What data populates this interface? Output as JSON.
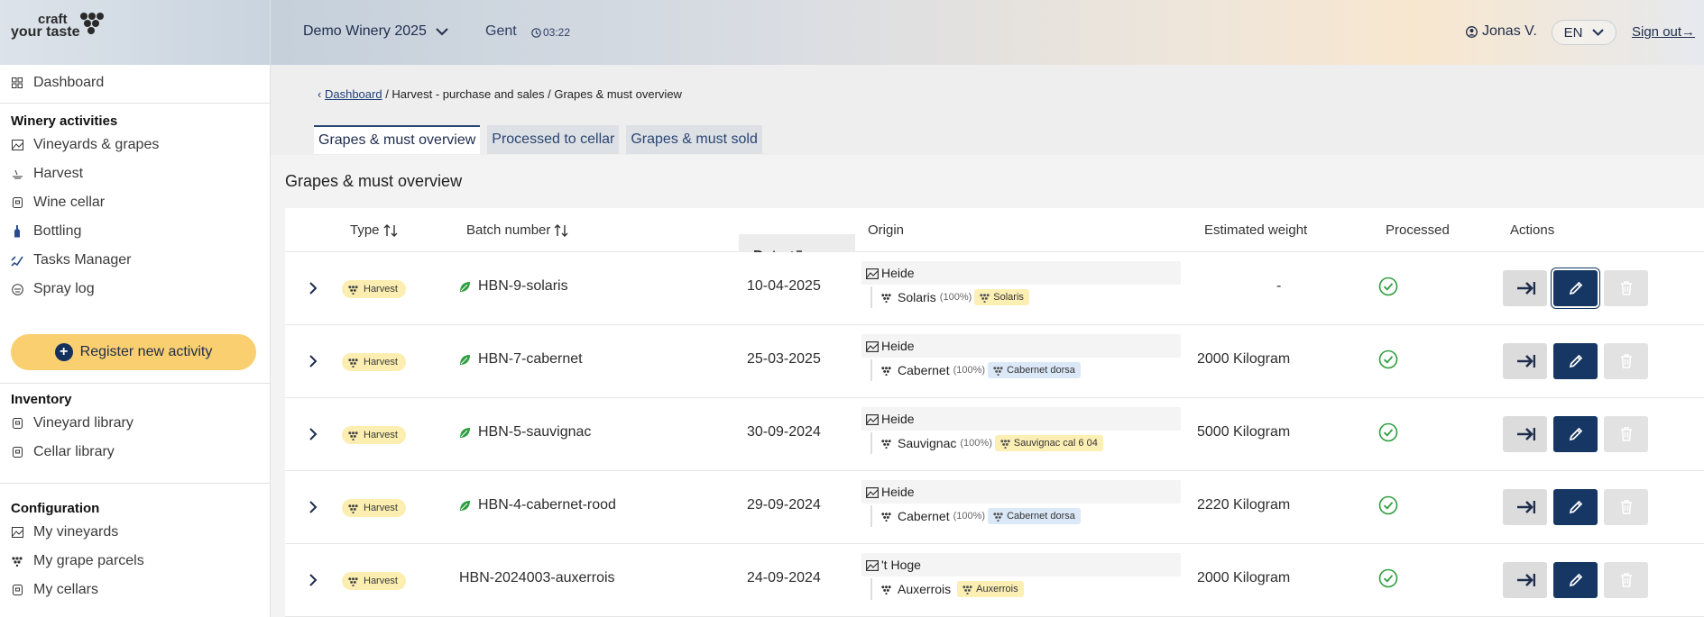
{
  "logo": {
    "line1": "craft",
    "line2": "your taste"
  },
  "sidebar": {
    "dashboard": "Dashboard",
    "winery_title": "Winery activities",
    "winery_items": [
      "Vineyards & grapes",
      "Harvest",
      "Wine cellar",
      "Bottling",
      "Tasks Manager",
      "Spray log"
    ],
    "register_label": "Register new activity",
    "inventory_title": "Inventory",
    "inventory_items": [
      "Vineyard library",
      "Cellar library"
    ],
    "config_title": "Configuration",
    "config_items": [
      "My vineyards",
      "My grape parcels",
      "My cellars"
    ]
  },
  "header": {
    "winery": "Demo Winery 2025",
    "city": "Gent",
    "time": "03:22",
    "user": "Jonas V.",
    "lang": "EN",
    "signout": "Sign out"
  },
  "breadcrumb": {
    "back": "‹",
    "link": "Dashboard",
    "rest": " / Harvest - purchase and sales / Grapes & must overview"
  },
  "tabs": [
    "Grapes & must overview",
    "Processed to cellar",
    "Grapes & must sold"
  ],
  "page_title": "Grapes & must overview",
  "table": {
    "headers": {
      "type": "Type",
      "batch": "Batch number",
      "date": "Date",
      "origin": "Origin",
      "weight": "Estimated weight",
      "processed": "Processed",
      "actions": "Actions"
    },
    "rows": [
      {
        "type": "Harvest",
        "batch": "HBN-9-solaris",
        "leaf": true,
        "date": "10-04-2025",
        "origin": "Heide",
        "variety": "Solaris",
        "pct": "(100%)",
        "chip": "Solaris",
        "chip_color": "yellow",
        "weight": "-",
        "processed": true
      },
      {
        "type": "Harvest",
        "batch": "HBN-7-cabernet",
        "leaf": true,
        "date": "25-03-2025",
        "origin": "Heide",
        "variety": "Cabernet",
        "pct": "(100%)",
        "chip": "Cabernet dorsa",
        "chip_color": "blue",
        "weight": "2000 Kilogram",
        "processed": true
      },
      {
        "type": "Harvest",
        "batch": "HBN-5-sauvignac",
        "leaf": true,
        "date": "30-09-2024",
        "origin": "Heide",
        "variety": "Sauvignac",
        "pct": "(100%)",
        "chip": "Sauvignac cal 6 04",
        "chip_color": "yellow",
        "weight": "5000 Kilogram",
        "processed": true
      },
      {
        "type": "Harvest",
        "batch": "HBN-4-cabernet-rood",
        "leaf": true,
        "date": "29-09-2024",
        "origin": "Heide",
        "variety": "Cabernet",
        "pct": "(100%)",
        "chip": "Cabernet dorsa",
        "chip_color": "blue",
        "weight": "2220 Kilogram",
        "processed": true
      },
      {
        "type": "Harvest",
        "batch": "HBN-2024003-auxerrois",
        "leaf": false,
        "date": "24-09-2024",
        "origin": "'t Hoge",
        "variety": "Auxerrois",
        "pct": "",
        "chip": "Auxerrois",
        "chip_color": "yellow",
        "weight": "2000 Kilogram",
        "processed": true
      }
    ]
  },
  "colors": {
    "accent_navy": "#163763",
    "register_yellow": "#f9cf6f",
    "check_green": "#2e9e3f",
    "leaf_green": "#2e9e3f"
  }
}
